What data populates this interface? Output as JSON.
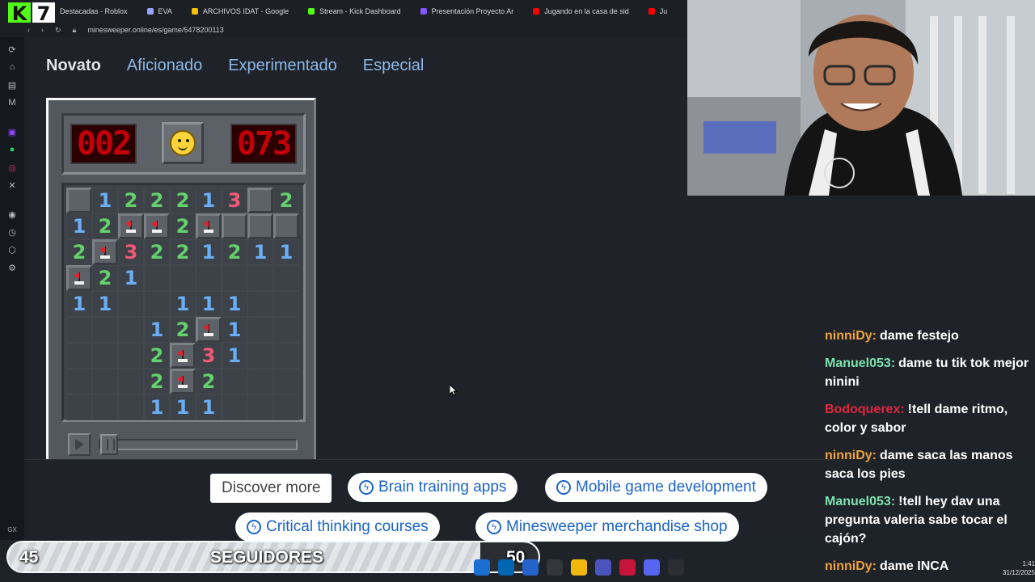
{
  "browser": {
    "tabs": [
      {
        "label": "Destacadas - Roblox",
        "color": "#cccccc"
      },
      {
        "label": "EVA",
        "color": "#9aa4ff"
      },
      {
        "label": "ARCHIVOS IDAT - Google",
        "color": "#f4c20d"
      },
      {
        "label": "Stream - Kick Dashboard",
        "color": "#53fc18"
      },
      {
        "label": "Presentación Proyecto Ar",
        "color": "#7e57ff"
      },
      {
        "label": "Jugando en la casa de sid",
        "color": "#ff0000"
      },
      {
        "label": "Ju",
        "color": "#ff0000"
      }
    ],
    "url": "minesweeper.online/es/game/5478200113"
  },
  "levels": [
    {
      "label": "Novato",
      "active": true
    },
    {
      "label": "Aficionado",
      "active": false
    },
    {
      "label": "Experimentado",
      "active": false
    },
    {
      "label": "Especial",
      "active": false
    }
  ],
  "game": {
    "mines_left": "002",
    "timer": "073",
    "board": [
      [
        "h",
        "1",
        "2",
        "2",
        "2",
        "1",
        "3",
        "h",
        "2"
      ],
      [
        "1",
        "2",
        "F",
        "F",
        "2",
        "F",
        "h",
        "h",
        "h"
      ],
      [
        "2",
        "F",
        "3",
        "2",
        "2",
        "1",
        "2",
        "1",
        "1"
      ],
      [
        "F",
        "2",
        "1",
        "",
        "",
        "",
        "",
        "",
        ""
      ],
      [
        "1",
        "1",
        "",
        "",
        "1",
        "1",
        "1",
        "",
        ""
      ],
      [
        "",
        "",
        "",
        "1",
        "2",
        "F",
        "1",
        "",
        ""
      ],
      [
        "",
        "",
        "",
        "2",
        "F",
        "3",
        "1",
        "",
        ""
      ],
      [
        "",
        "",
        "",
        "2",
        "F",
        "2",
        "",
        "",
        ""
      ],
      [
        "",
        "",
        "",
        "1",
        "1",
        "1",
        "",
        "",
        ""
      ]
    ]
  },
  "ads": {
    "discover": "Discover more",
    "chips": [
      "Brain training apps",
      "Mobile game development",
      "Critical thinking courses",
      "Minesweeper merchandise shop"
    ]
  },
  "chat": [
    {
      "user": "ninniDy:",
      "text": "dame festejo",
      "cls": "u-ninni"
    },
    {
      "user": "Manuel053:",
      "text": "dame tu tik tok mejor ninini",
      "cls": "u-manuel"
    },
    {
      "user": "Bodoquerex:",
      "text": "!tell dame ritmo, color y sabor",
      "cls": "u-bodo"
    },
    {
      "user": "ninniDy:",
      "text": "dame saca las manos saca los pies",
      "cls": "u-ninni"
    },
    {
      "user": "Manuel053:",
      "text": "!tell hey dav una pregunta valeria sabe tocar el cajón?",
      "cls": "u-manuel"
    },
    {
      "user": "ninniDy:",
      "text": "dame INCA",
      "cls": "u-ninni"
    }
  ],
  "followers": {
    "current": "45",
    "label": "SEGUIDORES",
    "target": "50",
    "progress": 0.9
  },
  "clock": {
    "time": "1:41",
    "date": "31/12/2025"
  }
}
